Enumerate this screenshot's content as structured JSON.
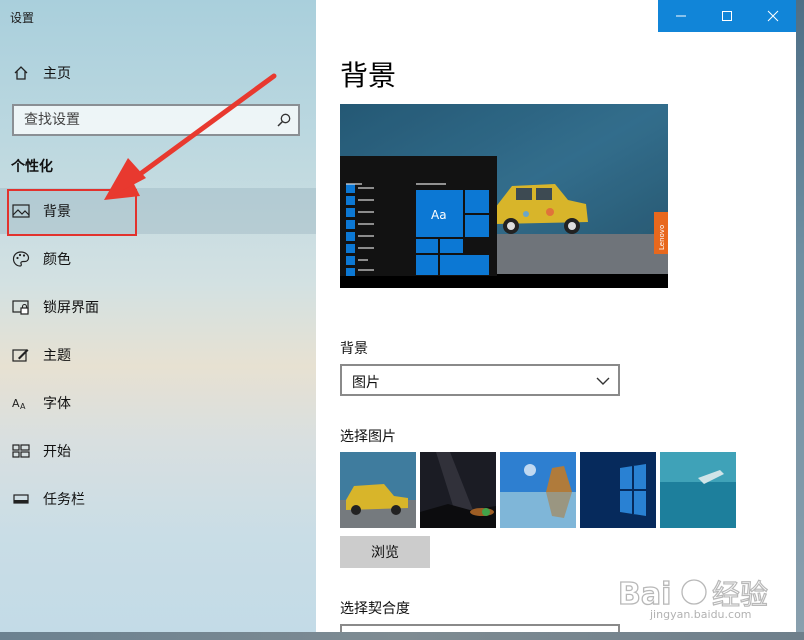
{
  "window": {
    "title": "设置"
  },
  "sidebar": {
    "home": "主页",
    "search_placeholder": "查找设置",
    "section": "个性化",
    "items": [
      {
        "label": "背景",
        "icon": "picture-icon",
        "selected": true
      },
      {
        "label": "颜色",
        "icon": "palette-icon"
      },
      {
        "label": "锁屏界面",
        "icon": "lock-screen-icon"
      },
      {
        "label": "主题",
        "icon": "theme-brush-icon"
      },
      {
        "label": "字体",
        "icon": "font-icon"
      },
      {
        "label": "开始",
        "icon": "start-grid-icon"
      },
      {
        "label": "任务栏",
        "icon": "taskbar-icon"
      }
    ]
  },
  "main": {
    "title": "背景",
    "preview_tile_text": "Aa",
    "preview_brand": "Lenovo",
    "background_label": "背景",
    "background_value": "图片",
    "choose_picture_label": "选择图片",
    "browse_label": "浏览",
    "fit_label": "选择契合度"
  },
  "watermark": {
    "text": "Baidu经验",
    "url": "jingyan.baidu.com"
  },
  "colors": {
    "accent": "#0c78d4",
    "titlebar": "#1185d8",
    "annotation": "#e2322d"
  }
}
